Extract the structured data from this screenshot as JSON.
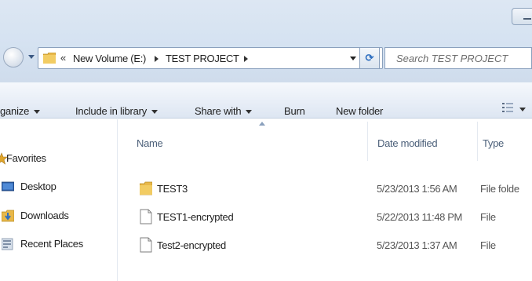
{
  "breadcrumb": {
    "overflow": "«",
    "items": [
      "New Volume (E:)",
      "TEST PROJECT"
    ]
  },
  "search": {
    "placeholder": "Search TEST PROJECT"
  },
  "commandbar": {
    "organize": "ganize",
    "include_in_library": "Include in library",
    "share_with": "Share with",
    "burn": "Burn",
    "new_folder": "New folder"
  },
  "navpane": {
    "favorites": "Favorites",
    "items": [
      {
        "label": "Desktop",
        "icon": "desktop-icon"
      },
      {
        "label": "Downloads",
        "icon": "downloads-icon"
      },
      {
        "label": "Recent Places",
        "icon": "recent-places-icon"
      }
    ]
  },
  "columns": {
    "name": "Name",
    "date_modified": "Date modified",
    "type": "Type"
  },
  "files": [
    {
      "name": "TEST3",
      "date": "5/23/2013 1:56 AM",
      "type": "File folde",
      "icon": "folder-icon"
    },
    {
      "name": "TEST1-encrypted",
      "date": "5/22/2013 11:48 PM",
      "type": "File",
      "icon": "file-icon"
    },
    {
      "name": "Test2-encrypted",
      "date": "5/23/2013 1:37 AM",
      "type": "File",
      "icon": "file-icon"
    }
  ],
  "colors": {
    "folder": "#e8b84a",
    "accent": "#2f6fc0",
    "header_text": "#4c607a"
  }
}
